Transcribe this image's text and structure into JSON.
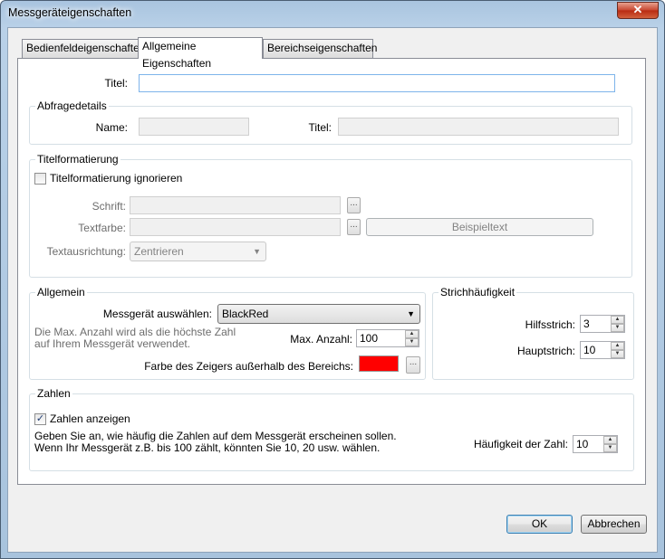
{
  "window": {
    "title": "Messgeräteigenschaften",
    "close_glyph": "✕"
  },
  "tabs": [
    {
      "label": "Bedienfeldeigenschaften"
    },
    {
      "label": "Allgemeine Eigenschaften"
    },
    {
      "label": "Bereichseigenschaften"
    }
  ],
  "general": {
    "title_label": "Titel:",
    "title_value": ""
  },
  "query_details": {
    "legend": "Abfragedetails",
    "name_label": "Name:",
    "name_value": "",
    "title_label": "Titel:",
    "title_value": ""
  },
  "title_format": {
    "legend": "Titelformatierung",
    "ignore_label": "Titelformatierung ignorieren",
    "ignore_checked": false,
    "font_label": "Schrift:",
    "color_label": "Textfarbe:",
    "browse_label": "...",
    "sample_button": "Beispieltext",
    "align_label": "Textausrichtung:",
    "align_value": "Zentrieren"
  },
  "allgemein": {
    "legend": "Allgemein",
    "meter_label": "Messgerät auswählen:",
    "meter_value": "BlackRed",
    "max_hint_line1": "Die Max. Anzahl wird als die höchste Zahl",
    "max_hint_line2": "auf Ihrem Messgerät verwendet.",
    "max_label": "Max. Anzahl:",
    "max_value": "100",
    "pointer_color_label": "Farbe des Zeigers außerhalb des Bereichs:",
    "pointer_color": "#ff0000",
    "browse_label": "..."
  },
  "strich": {
    "legend": "Strichhäufigkeit",
    "minor_label": "Hilfsstrich:",
    "minor_value": "3",
    "major_label": "Hauptstrich:",
    "major_value": "10"
  },
  "zahlen": {
    "legend": "Zahlen",
    "show_label": "Zahlen anzeigen",
    "show_checked": true,
    "check_glyph": "✓",
    "hint_line1": "Geben Sie an, wie häufig die Zahlen auf dem Messgerät erscheinen sollen.",
    "hint_line2": "Wenn Ihr Messgerät z.B. bis 100 zählt, könnten Sie 10, 20 usw. wählen.",
    "freq_label": "Häufigkeit der Zahl:",
    "freq_value": "10"
  },
  "buttons": {
    "ok": "OK",
    "cancel": "Abbrechen"
  },
  "glyphs": {
    "up": "▲",
    "down": "▼",
    "dropdown": "▼"
  }
}
